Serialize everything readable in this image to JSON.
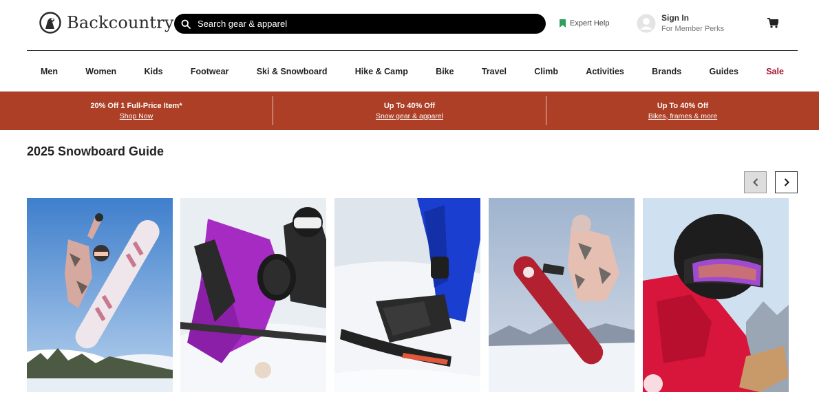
{
  "brand": {
    "name": "Backcountry"
  },
  "search": {
    "placeholder": "Search gear & apparel"
  },
  "expert_help": {
    "label": "Expert Help"
  },
  "account": {
    "title": "Sign In",
    "subtitle": "For Member Perks"
  },
  "nav": {
    "items": [
      "Men",
      "Women",
      "Kids",
      "Footwear",
      "Ski & Snowboard",
      "Hike & Camp",
      "Bike",
      "Travel",
      "Climb",
      "Activities",
      "Brands",
      "Guides",
      "Sale"
    ]
  },
  "promo": [
    {
      "title": "20% Off 1 Full-Price Item*",
      "link": "Shop Now"
    },
    {
      "title": "Up To 40% Off",
      "link": "Snow gear & apparel"
    },
    {
      "title": "Up To 40% Off",
      "link": "Bikes, frames & more"
    }
  ],
  "section": {
    "title": "2025 Snowboard Guide"
  },
  "colors": {
    "promo_bg": "#ad3f26",
    "sale": "#a6192e",
    "expert_icon": "#2f9e5f"
  },
  "icons": [
    "logo-mark-icon",
    "search-icon",
    "bookmark-icon",
    "avatar-icon",
    "cart-icon",
    "chevron-left-icon",
    "chevron-right-icon"
  ]
}
